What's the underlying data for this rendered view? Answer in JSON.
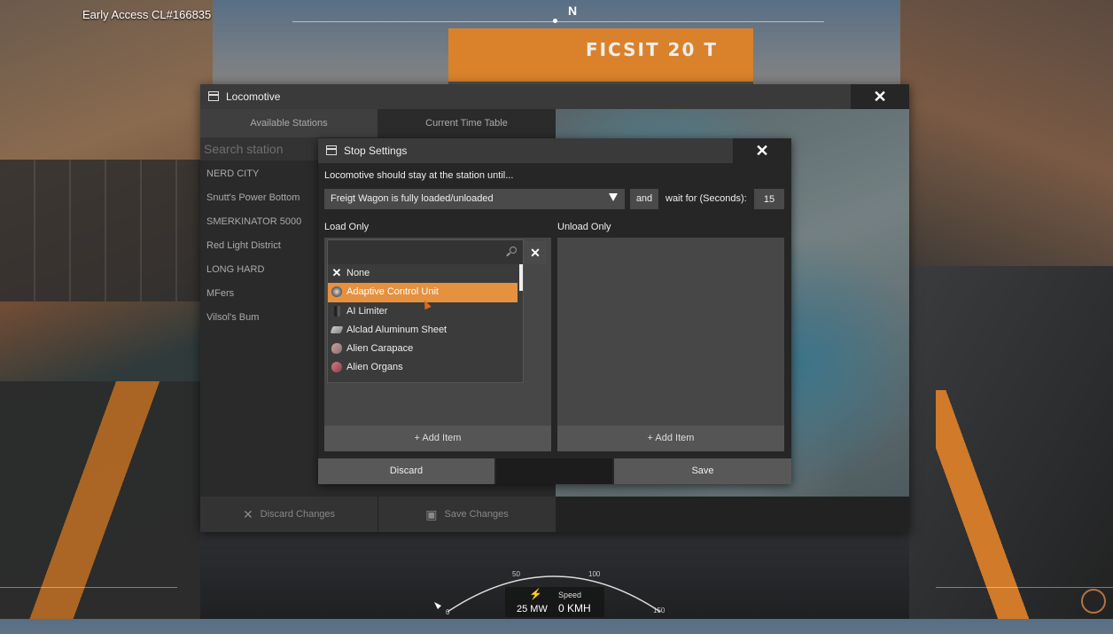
{
  "hud": {
    "build": "Early Access CL#166835",
    "compass_heading": "N",
    "gantry_text": "FICSIT 20 T",
    "power": "25 MW",
    "speed_label": "Speed",
    "speed": "0 KMH",
    "gauge_ticks": [
      "0",
      "50",
      "100",
      "150"
    ]
  },
  "locomotive": {
    "title": "Locomotive",
    "tabs": [
      "Available Stations",
      "Current Time Table"
    ],
    "search_placeholder": "Search station",
    "stations": [
      "NERD CITY",
      "Snutt's Power Bottom",
      "SMERKINATOR 5000",
      "Red Light District",
      "LONG HARD",
      "MFers",
      "Vilsol's Bum"
    ],
    "discard_changes": "Discard Changes",
    "save_changes": "Save Changes"
  },
  "stop_settings": {
    "title": "Stop Settings",
    "condition_label": "Locomotive should stay at the station until...",
    "condition_value": "Freigt Wagon is fully loaded/unloaded",
    "and_label": "and",
    "wait_label": "wait for (Seconds):",
    "wait_value": "15",
    "load_only": "Load Only",
    "unload_only": "Unload Only",
    "add_item": "+ Add Item",
    "discard": "Discard",
    "save": "Save",
    "item_search_value": "",
    "items": [
      {
        "label": "None",
        "icon": "close-icon",
        "selected": false
      },
      {
        "label": "Adaptive Control Unit",
        "icon": "adaptive-control-unit-icon",
        "selected": true
      },
      {
        "label": "AI Limiter",
        "icon": "ai-limiter-icon",
        "selected": false
      },
      {
        "label": "Alclad Aluminum Sheet",
        "icon": "alclad-sheet-icon",
        "selected": false
      },
      {
        "label": "Alien Carapace",
        "icon": "alien-carapace-icon",
        "selected": false
      },
      {
        "label": "Alien Organs",
        "icon": "alien-organs-icon",
        "selected": false
      }
    ]
  },
  "colors": {
    "accent": "#e5913f",
    "panel": "#474747",
    "button": "#585858"
  }
}
